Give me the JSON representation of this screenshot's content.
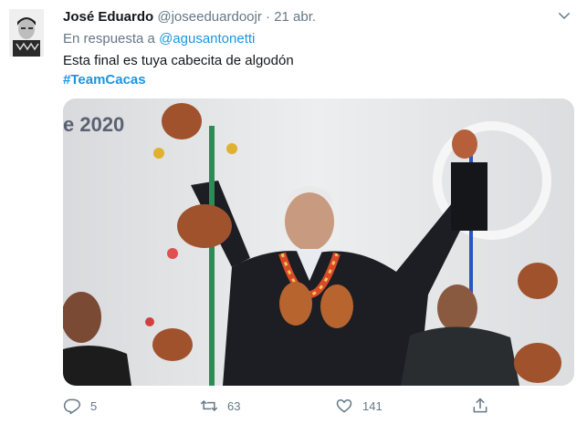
{
  "tweet": {
    "author_name": "José Eduardo",
    "author_handle": "@joseeduardoojr",
    "separator": "·",
    "date": "21 abr.",
    "reply_prefix": "En respuesta a ",
    "reply_mention": "@agusantonetti",
    "text": "Esta final es tuya cabecita de algodón",
    "hashtag": "#TeamCacas"
  },
  "media": {
    "background_text": "e 2020"
  },
  "actions": {
    "reply_count": "5",
    "retweet_count": "63",
    "like_count": "141"
  },
  "icons": {
    "caret": "chevron-down-icon",
    "reply": "reply-bubble-icon",
    "retweet": "retweet-icon",
    "like": "heart-icon",
    "share": "share-icon"
  },
  "colors": {
    "link": "#1b95e0",
    "secondary": "#657786",
    "text": "#14171a"
  }
}
